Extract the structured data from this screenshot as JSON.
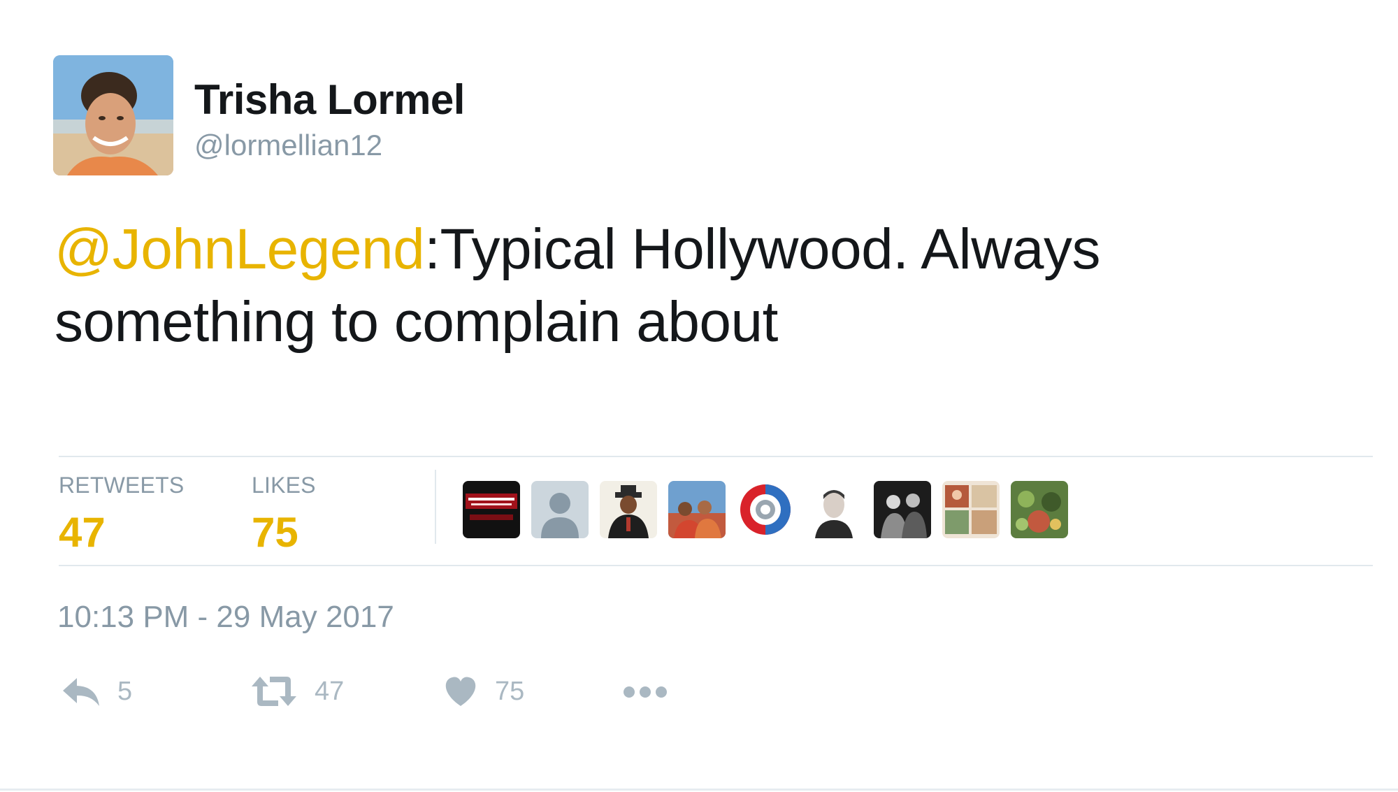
{
  "author": {
    "display_name": "Trisha Lormel",
    "handle": "@lormellian12",
    "avatar": "profile-photo-icon"
  },
  "tweet": {
    "mention": "@JohnLegend",
    "text": ":Typical Hollywood. Always something to complain about"
  },
  "stats": {
    "retweets_label": "RETWEETS",
    "retweets_value": "47",
    "likes_label": "LIKES",
    "likes_value": "75"
  },
  "likers": [
    {
      "icon": "liker-avatar-banner-icon"
    },
    {
      "icon": "default-profile-icon"
    },
    {
      "icon": "liker-avatar-hat-man-icon"
    },
    {
      "icon": "liker-avatar-group-icon"
    },
    {
      "icon": "liker-avatar-target-logo-icon"
    },
    {
      "icon": "liker-avatar-portrait-icon"
    },
    {
      "icon": "liker-avatar-bw-photo-icon"
    },
    {
      "icon": "liker-avatar-collage-icon"
    },
    {
      "icon": "liker-avatar-green-photo-icon"
    }
  ],
  "timestamp": "10:13 PM - 29 May 2017",
  "actions": {
    "reply_count": "5",
    "retweet_count": "47",
    "like_count": "75"
  },
  "colors": {
    "accent": "#e8b400",
    "muted": "#8899a6",
    "action_gray": "#aab8c2",
    "text": "#14171a",
    "divider": "#e1e8ed"
  }
}
